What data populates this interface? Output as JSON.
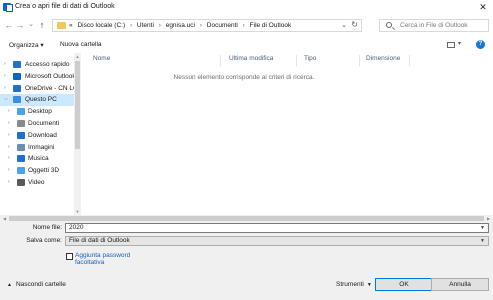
{
  "window": {
    "title": "Crea o apri file di dati di Outlook",
    "close_glyph": "✕"
  },
  "nav_buttons": {
    "back": "←",
    "forward": "→",
    "up_dropdown": "⌄",
    "up": "↑"
  },
  "address": {
    "crumbs": [
      "«",
      "Disco locale (C:)",
      "Utenti",
      "egnisa.uci",
      "Documenti",
      "File di Outlook"
    ],
    "separator": "›",
    "dropdown_glyph": "⌄",
    "refresh_glyph": "↻"
  },
  "search": {
    "placeholder": "Cerca in File di Outlook"
  },
  "toolbar": {
    "organize": "Organizza ▾",
    "new_folder": "Nuova cartella",
    "view_dropdown": "▾",
    "help": "?"
  },
  "nav": {
    "items": [
      {
        "label": "Accesso rapido",
        "icon": "star-icon",
        "color": "#1f6fd0",
        "child": false,
        "selected": false
      },
      {
        "label": "Microsoft Outlook",
        "icon": "outlook-icon",
        "color": "#0a64c8",
        "child": false,
        "selected": false
      },
      {
        "label": "OneDrive - CN LO",
        "icon": "cloud-icon",
        "color": "#1f6fd0",
        "child": false,
        "selected": false
      },
      {
        "label": "Questo PC",
        "icon": "computer-icon",
        "color": "#3a8ee6",
        "child": false,
        "selected": true
      },
      {
        "label": "Desktop",
        "icon": "desktop-folder-icon",
        "color": "#4aa3f0",
        "child": true,
        "selected": false
      },
      {
        "label": "Documenti",
        "icon": "documents-folder-icon",
        "color": "#8a8a8a",
        "child": true,
        "selected": false
      },
      {
        "label": "Download",
        "icon": "download-folder-icon",
        "color": "#1f6fd0",
        "child": true,
        "selected": false
      },
      {
        "label": "Immagini",
        "icon": "pictures-folder-icon",
        "color": "#6a8fb3",
        "child": true,
        "selected": false
      },
      {
        "label": "Musica",
        "icon": "music-folder-icon",
        "color": "#1f6fd0",
        "child": true,
        "selected": false
      },
      {
        "label": "Oggetti 3D",
        "icon": "3d-objects-folder-icon",
        "color": "#4aa3f0",
        "child": true,
        "selected": false
      },
      {
        "label": "Video",
        "icon": "videos-folder-icon",
        "color": "#5a5a5a",
        "child": true,
        "selected": false
      }
    ]
  },
  "columns": [
    {
      "label": "Nome"
    },
    {
      "label": "Ultima modifica"
    },
    {
      "label": "Tipo"
    },
    {
      "label": "Dimensione"
    }
  ],
  "empty_message": "Nessun elemento corrisponde ai criteri di ricerca.",
  "form": {
    "filename_label": "Nome file:",
    "filename_value": "2020",
    "saveas_label": "Salva come:",
    "saveas_value": "File di dati di Outlook",
    "password_label": "Aggiunta password facoltativa",
    "hide_folders": "Nascondi cartelle",
    "tools": "Strumenti",
    "ok": "OK",
    "cancel": "Annulla"
  }
}
